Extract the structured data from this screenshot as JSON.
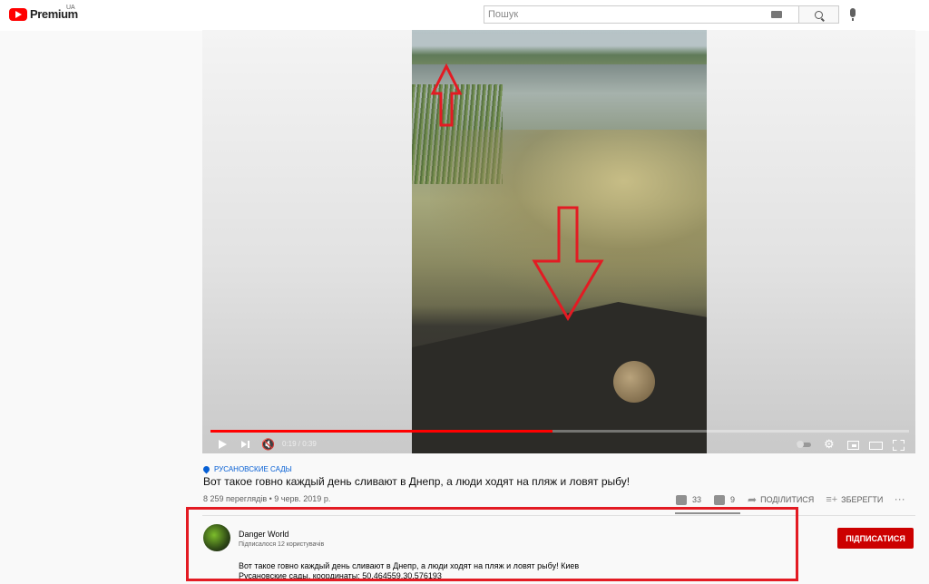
{
  "header": {
    "logo_text": "Premium",
    "region": "UA",
    "search_placeholder": "Пошук"
  },
  "player": {
    "progress_fraction": 0.49,
    "time": "0:19 / 0:39",
    "accent_color": "#ff0000"
  },
  "video": {
    "location": "РУСАНОВСКИЕ САДЫ",
    "title": "Вот такое говно каждый день сливают в Днепр, а люди ходят на пляж и ловят рыбу!",
    "views_date": "8 259 переглядів • 9 черв. 2019 р.",
    "likes": "33",
    "dislikes": "9",
    "share_label": "ПОДІЛИТИСЯ",
    "save_label": "ЗБЕРЕГТИ"
  },
  "channel": {
    "name": "Danger World",
    "subscribers": "Підписалося 12 користувачів",
    "subscribe_label": "ПІДПИСАТИСЯ",
    "description_line1": "Вот такое говно каждый день сливают в Днепр, а люди ходят на пляж и ловят рыбу! Киев",
    "description_line2": "Русановские сады, координаты: 50.464559,30.576193",
    "highlight_color": "#e31b23"
  }
}
